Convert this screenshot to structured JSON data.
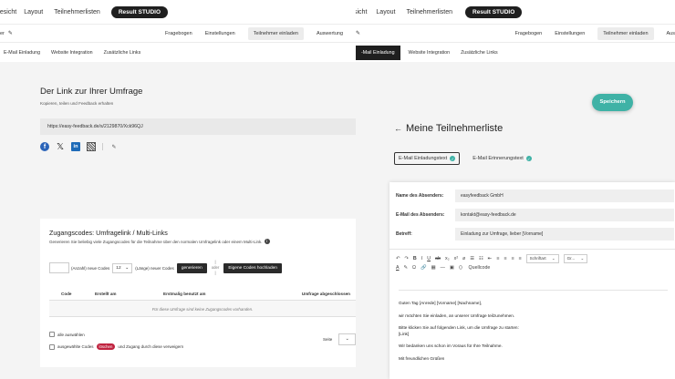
{
  "left": {
    "topnav": {
      "item1": "pesicht",
      "item2": "Layout",
      "item3": "Teilnehmerlisten",
      "result": "Result STUDIO"
    },
    "subnav": {
      "crumb": "er",
      "items": [
        "Fragebogen",
        "Einstellungen",
        "Teilnehmer einladen",
        "Auswertung"
      ]
    },
    "tabs": [
      "E-Mail Einladung",
      "Website Integration",
      "Zusätzliche Links"
    ],
    "link": {
      "title": "Der Link zur Ihrer Umfrage",
      "subtitle": "Kopieren, teilen und Feedback erhalten",
      "url": "https://easy-feedback.de/s/2129870/Xck96QJ"
    },
    "codes": {
      "title": "Zugangscodes: Umfragelink / Multi-Links",
      "desc": "Generieren Sie beliebig viele Zugangscodes für die Teilnahme über den normalen Umfragelink oder einem Multi-Link.",
      "count_label": "(Anzahl) neue Codes",
      "length_value": "12",
      "length_label": "(Länge) neuer Codes",
      "generate": "generieren",
      "or_label": "oder",
      "upload": "Eigene Codes hochladen",
      "columns": [
        "Code",
        "Erstellt am",
        "Erstmalig benutzt am",
        "Umfrage abgeschlossen"
      ],
      "empty": "Für diese Umfrage sind keine Zugangscodes vorhanden.",
      "select_all": "alle auswählen",
      "selected_prefix": "ausgewählte Codes",
      "delete": "löschen",
      "selected_suffix": "und Zugang durch diese verweigern",
      "page_label": "Seite"
    }
  },
  "right": {
    "topnav": {
      "item1": "sicht",
      "item2": "Layout",
      "item3": "Teilnehmerlisten",
      "result": "Result STUDIO"
    },
    "subnav": {
      "items": [
        "Fragebogen",
        "Einstellungen",
        "Teilnehmer einladen",
        "Aus"
      ]
    },
    "tabs": [
      "-Mail Einladung",
      "Website Integration",
      "Zusätzliche Links"
    ],
    "save": "Speichern",
    "title": "Meine Teilnehmerliste",
    "mail_tabs": [
      "E-Mail Einladungstext",
      "E-Mail Erinnerungstext"
    ],
    "form": {
      "sender_label": "Name des Absenders:",
      "sender_value": "easyfeedback GmbH",
      "email_label": "E-Mail des Absenders:",
      "email_value": "kontakt@easy-feedback.de",
      "subject_label": "Betreff:",
      "subject_value": "Einladung zur Umfrage, lieber [Vorname]"
    },
    "editor": {
      "font_label": "Schriftart",
      "size_label": "Gr...",
      "source_label": "Quellcode",
      "lines": [
        "Guten Tag [Anrede] [Vorname] [Nachname],",
        "wir möchten Sie einladen, an unserer Umfrage teilzunehmen.",
        "Bitte klicken Sie auf folgenden Link, um die Umfrage zu starten:",
        "[Link]",
        "Wir bedanken uns schon im Voraus für Ihre Teilnahme.",
        "Mit freundlichen Grüßen"
      ]
    }
  },
  "colors": {
    "accent": "#3fb2a6",
    "dark": "#1f1f1f",
    "danger": "#c0233f"
  }
}
